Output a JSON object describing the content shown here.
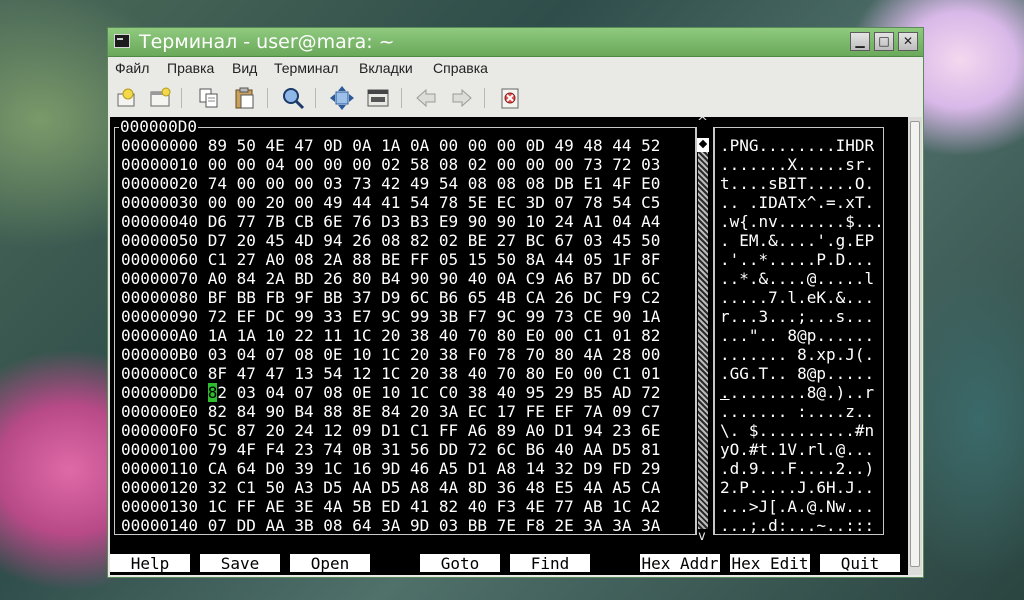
{
  "window": {
    "title": "Терминал - user@mara: ~",
    "controls": {
      "minimize": "▁",
      "maximize": "□",
      "close": "✕"
    }
  },
  "menu": [
    "Файл",
    "Правка",
    "Вид",
    "Терминал",
    "Вкладки",
    "Справка"
  ],
  "toolbar": [
    "new-tab-icon",
    "new-window-icon",
    "copy-icon",
    "paste-icon",
    "search-icon",
    "fullscreen-icon",
    "set-title-icon",
    "back-icon",
    "forward-icon",
    "close-tab-icon"
  ],
  "editor": {
    "offset_label": "000000D0",
    "hex_rows": [
      "00000000 89 50 4E 47 0D 0A 1A 0A 00 00 00 0D 49 48 44 52",
      "00000010 00 00 04 00 00 00 02 58 08 02 00 00 00 73 72 03",
      "00000020 74 00 00 00 03 73 42 49 54 08 08 08 DB E1 4F E0",
      "00000030 00 00 20 00 49 44 41 54 78 5E EC 3D 07 78 54 C5",
      "00000040 D6 77 7B CB 6E 76 D3 B3 E9 90 90 10 24 A1 04 A4",
      "00000050 D7 20 45 4D 94 26 08 82 02 BE 27 BC 67 03 45 50",
      "00000060 C1 27 A0 08 2A 88 BE FF 05 15 50 8A 44 05 1F 8F",
      "00000070 A0 84 2A BD 26 80 B4 90 90 40 0A C9 A6 B7 DD 6C",
      "00000080 BF BB FB 9F BB 37 D9 6C B6 65 4B CA 26 DC F9 C2",
      "00000090 72 EF DC 99 33 E7 9C 99 3B F7 9C 99 73 CE 90 1A",
      "000000A0 1A 1A 10 22 11 1C 20 38 40 70 80 E0 00 C1 01 82",
      "000000B0 03 04 07 08 0E 10 1C 20 38 F0 78 70 80 4A 28 00",
      "000000C0 8F 47 47 13 54 12 1C 20 38 40 70 80 E0 00 C1 01",
      "000000D0 82 03 04 07 08 0E 10 1C C0 38 40 95 29 B5 AD 72",
      "000000E0 82 84 90 B4 88 8E 84 20 3A EC 17 FE EF 7A 09 C7",
      "000000F0 5C 87 20 24 12 09 D1 C1 FF A6 89 A0 D1 94 23 6E",
      "00000100 79 4F F4 23 74 0B 31 56 DD 72 6C B6 40 AA D5 81",
      "00000110 CA 64 D0 39 1C 16 9D 46 A5 D1 A8 14 32 D9 FD 29",
      "00000120 32 C1 50 A3 D5 AA D5 A8 4A 8D 36 48 E5 4A A5 CA",
      "00000130 1C FF AE 3E 4A 5B ED 41 82 40 F3 4E 77 AB 1C A2",
      "00000140 07 DD AA 3B 08 64 3A 9D 03 BB 7E F8 2E 3A 3A 3A"
    ],
    "cursor": {
      "row": 13,
      "prefix": "000000D0 ",
      "char": "8",
      "rest": "2 03 04 07 08 0E 10 1C C0 38 40 95 29 B5 AD 72"
    },
    "ascii_rows": [
      ".PNG........IHDR",
      ".......X.....sr.",
      "t....sBIT.....O.",
      ".. .IDATx^.=.xT.",
      ".w{.nv.......$...",
      ". EM.&....'.g.EP",
      ".'..*.....P.D...",
      "..*.&....@.....l",
      ".....7.l.eK.&...",
      "r...3...;...s...",
      "...\".. 8@p......",
      "....... 8.xp.J(.",
      ".GG.T.. 8@p.....",
      "........8@.)..r",
      "....... :....z..",
      "\\. $..........#n",
      "yO.#t.1V.rl.@...",
      ".d.9...F....2..)",
      "2.P.....J.6H.J..",
      "...>J[.A.@.Nw...",
      "...;.d:...~..:::"
    ],
    "ascii_cursor": {
      "row": 13,
      "char": ".",
      "rest": "........8@.)..r"
    }
  },
  "function_keys": [
    "Help",
    "Save",
    "Open",
    "Goto",
    "Find",
    "Hex Addr",
    "Hex Edit",
    "Quit"
  ]
}
